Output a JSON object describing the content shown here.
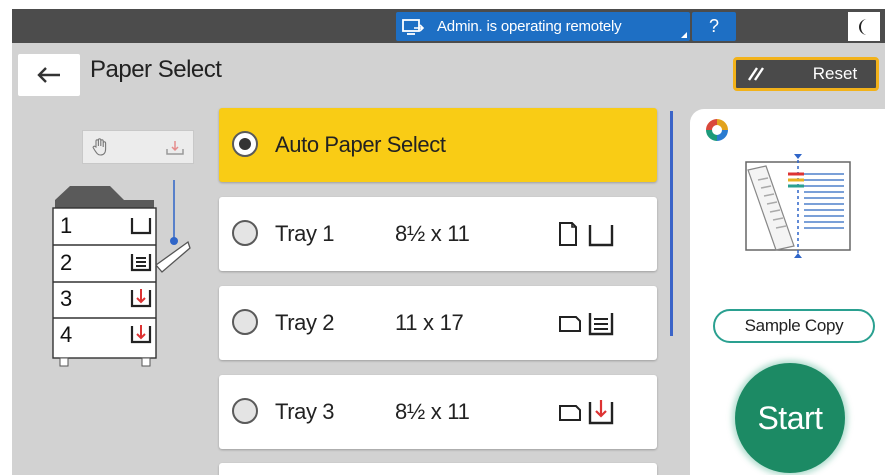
{
  "status_bar": {
    "remote_text": "Admin. is operating remotely",
    "help_label": "?",
    "remote_icon": "remote-monitor-icon",
    "theme_icon": "moon-icon"
  },
  "header": {
    "title": "Paper Select",
    "back_icon": "back-arrow-icon",
    "reset_label": "Reset",
    "reset_icon": "reset-slash-icon"
  },
  "machine": {
    "trays": [
      "1",
      "2",
      "3",
      "4"
    ],
    "toolbar_icons": [
      "bypass-hand-icon",
      "bypass-tray-icon"
    ]
  },
  "options": [
    {
      "label": "Auto Paper Select",
      "size": "",
      "selected": true
    },
    {
      "label": "Tray 1",
      "size": "8½ x 11",
      "selected": false,
      "icon": "portrait-paper-tray-icon"
    },
    {
      "label": "Tray 2",
      "size": "11 x 17",
      "selected": false,
      "icon": "landscape-paper-full-tray-icon"
    },
    {
      "label": "Tray 3",
      "size": "8½ x 11",
      "selected": false,
      "icon": "landscape-paper-low-tray-icon"
    }
  ],
  "right_panel": {
    "logo_icon": "app-logo-icon",
    "preview_icon": "document-preview-icon",
    "sample_copy_label": "Sample Copy",
    "start_label": "Start"
  },
  "colors": {
    "topbar": "#4c4c4c",
    "remote_blue": "#1e6fc4",
    "selected_yellow": "#f9cc15",
    "reset_border": "#f2b21a",
    "start_green": "#1c8a64",
    "sample_border": "#2aa090"
  }
}
